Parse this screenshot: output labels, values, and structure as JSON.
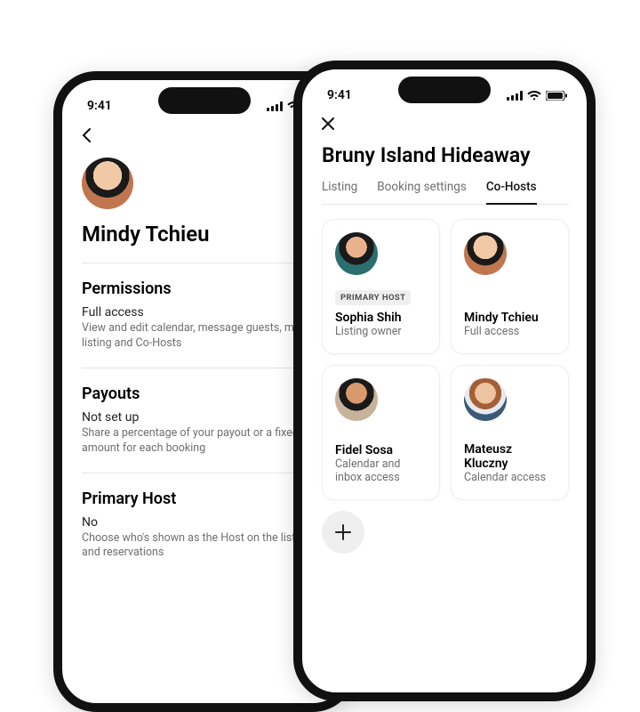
{
  "status": {
    "time": "9:41"
  },
  "left": {
    "name": "Mindy Tchieu",
    "sections": {
      "permissions": {
        "title": "Permissions",
        "value": "Full access",
        "desc": "View and edit calendar, message guests, manage listing and Co-Hosts"
      },
      "payouts": {
        "title": "Payouts",
        "value": "Not set up",
        "desc": "Share a percentage of your payout or a fixed amount for each booking"
      },
      "primary": {
        "title": "Primary Host",
        "value": "No",
        "desc": "Choose who's shown as the Host on the listing and reservations"
      }
    }
  },
  "right": {
    "title": "Bruny Island Hideaway",
    "tabs": {
      "listing": "Listing",
      "booking": "Booking settings",
      "cohosts": "Co-Hosts"
    },
    "badge_primary": "PRIMARY HOST",
    "hosts": [
      {
        "name": "Sophia Shih",
        "role": "Listing owner"
      },
      {
        "name": "Mindy Tchieu",
        "role": "Full access"
      },
      {
        "name": "Fidel Sosa",
        "role": "Calendar and inbox access"
      },
      {
        "name": "Mateusz Kluczny",
        "role": "Calendar access"
      }
    ]
  }
}
